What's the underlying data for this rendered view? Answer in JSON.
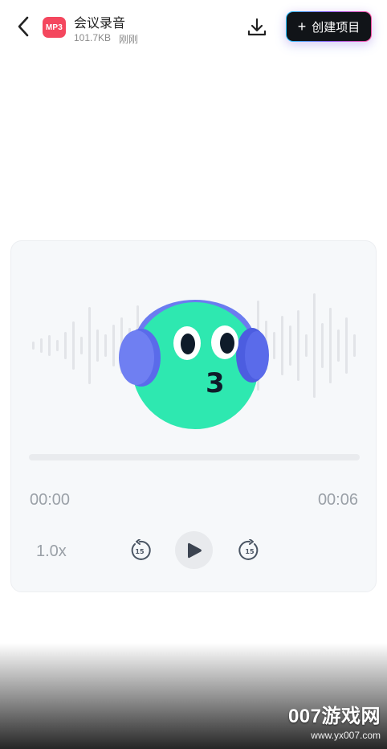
{
  "header": {
    "file_type_badge": "MP3",
    "file_name": "会议录音",
    "file_size": "101.7KB",
    "file_time": "刚刚",
    "create_button_label": "创建项目",
    "icons": {
      "back": "chevron-left-icon",
      "download": "download-icon",
      "plus": "plus-icon"
    }
  },
  "player": {
    "current_time": "00:00",
    "total_time": "00:06",
    "speed": "1.0x",
    "skip_back_seconds": "15",
    "skip_forward_seconds": "15",
    "progress": 0,
    "mascot_mouth_text": "3",
    "icons": {
      "skip_back": "rewind-15-icon",
      "play": "play-icon",
      "skip_forward": "forward-15-icon",
      "mascot": "headphones-mascot-icon"
    }
  },
  "watermark": {
    "main": "007游戏网",
    "url": "www.yx007.com"
  },
  "colors": {
    "badge": "#f4475e",
    "create_button_bg": "#111418",
    "mascot_face": "#2ee8b0",
    "headphones": "#6b7cf0",
    "secondary_text": "#9aa0a7"
  }
}
